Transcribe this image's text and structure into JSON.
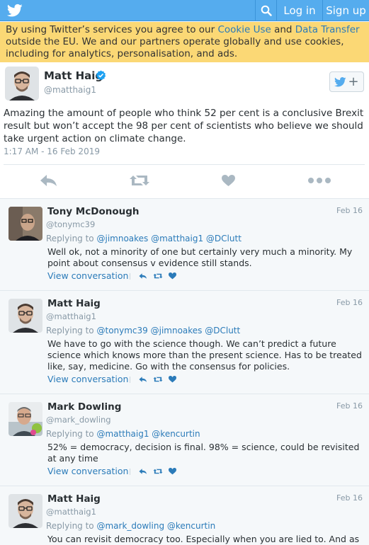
{
  "topbar": {
    "login": "Log in",
    "signup": "Sign up"
  },
  "cookie": {
    "text_1": "By using Twitter’s services you agree to our ",
    "link_1": "Cookie Use",
    "text_2": " and ",
    "link_2": "Data Transfer",
    "text_3": " outside the EU. We and our partners operate globally and use cookies, including for analytics, personalisation, and ads."
  },
  "main_tweet": {
    "name": "Matt Haig",
    "handle": "@matthaig1",
    "text": "Amazing the amount of people who think 52 per cent is a conclusive Brexit result but won’t accept the 98 per cent of scientists who believe we should take urgent action on climate change.",
    "time": "1:17 AM - 16 Feb 2019"
  },
  "replies": [
    {
      "name": "Tony McDonough",
      "handle": "@tonymc39",
      "date": "Feb 16",
      "replying_label": "Replying to",
      "mentions": "@jimnoakes @matthaig1 @DClutt",
      "text": "Well ok, not a minority of one but certainly very much a minority. My point about consensus v evidence still stands.",
      "view": "View conversation"
    },
    {
      "name": "Matt Haig",
      "handle": "@matthaig1",
      "date": "Feb 16",
      "replying_label": "Replying to",
      "mentions": "@tonymc39 @jimnoakes @DClutt",
      "text": "We have to go with the science though. We can’t predict a future science which knows more than the present science. Has to be treated like, say, medicine. Go with the consensus for policies.",
      "view": "View conversation"
    },
    {
      "name": "Mark Dowling",
      "handle": "@mark_dowling",
      "date": "Feb 16",
      "replying_label": "Replying to",
      "mentions": "@matthaig1 @kencurtin",
      "text": "52% = democracy, decision is final. 98% = science, could be revisited at any time",
      "view": "View conversation"
    },
    {
      "name": "Matt Haig",
      "handle": "@matthaig1",
      "date": "Feb 16",
      "replying_label": "Replying to",
      "mentions": "@mark_dowling @kencurtin",
      "text": "You can revisit democracy too. Especially when you are lied to. And as"
    }
  ]
}
